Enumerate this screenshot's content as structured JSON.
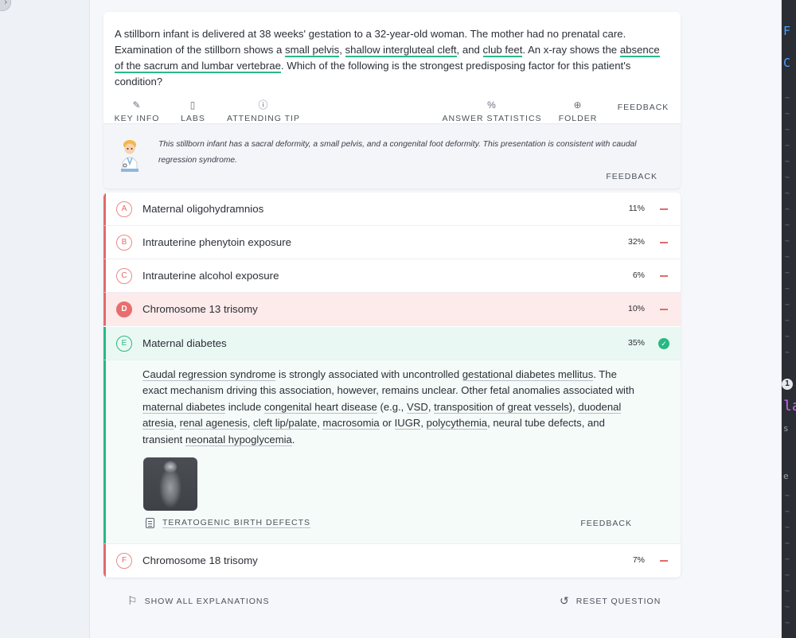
{
  "question": {
    "stem_parts": [
      "A stillborn infant is delivered at 38 weeks' gestation to a 32-year-old woman. The mother had no prenatal care. Examination of the stillborn shows a ",
      "small pelvis",
      ", ",
      "shallow intergluteal cleft",
      ", and ",
      "club feet",
      ". An x-ray shows the ",
      "absence of the sacrum and lumbar vertebrae",
      ". Which of the following is the strongest predisposing factor for this patient's condition?"
    ]
  },
  "toolbar": {
    "key_info": "KEY INFO",
    "labs": "LABS",
    "attending_tip": "ATTENDING TIP",
    "answer_statistics": "ANSWER STATISTICS",
    "folder": "FOLDER",
    "feedback": "FEEDBACK",
    "icons": {
      "key_info": "pencil-icon",
      "labs": "clipboard-icon",
      "attending_tip": "question-circle-icon",
      "answer_statistics": "percent-icon",
      "folder": "plus-circle-icon"
    }
  },
  "tip": {
    "text": "This stillborn infant has a sacral deformity, a small pelvis, and a congenital foot deformity. This presentation is consistent with caudal regression syndrome.",
    "feedback": "FEEDBACK"
  },
  "options": [
    {
      "letter": "A",
      "text": "Maternal oligohydramnios",
      "pct": "11%"
    },
    {
      "letter": "B",
      "text": "Intrauterine phenytoin exposure",
      "pct": "32%"
    },
    {
      "letter": "C",
      "text": "Intrauterine alcohol exposure",
      "pct": "6%"
    },
    {
      "letter": "D",
      "text": "Chromosome 13 trisomy",
      "pct": "10%"
    },
    {
      "letter": "E",
      "text": "Maternal diabetes",
      "pct": "35%"
    },
    {
      "letter": "F",
      "text": "Chromosome 18 trisomy",
      "pct": "7%"
    }
  ],
  "explanation": {
    "p": [
      "Caudal regression syndrome",
      " is strongly associated with uncontrolled ",
      "gestational diabetes mellitus",
      ". The exact mechanism driving this association, however, remains unclear. Other fetal anomalies associated with ",
      "maternal diabetes",
      " include ",
      "congenital heart disease",
      " (e.g., ",
      "VSD",
      ", ",
      "transposition of great vessels",
      "), ",
      "duodenal atresia",
      ", ",
      "renal agenesis",
      ", ",
      "cleft lip/palate",
      ", ",
      "macrosomia",
      " or ",
      "IUGR",
      ", ",
      "polycythemia",
      ", neural tube defects, and transient ",
      "neonatal hypoglycemia",
      "."
    ],
    "reference": "TERATOGENIC BIRTH DEFECTS",
    "feedback": "FEEDBACK"
  },
  "footer": {
    "show_all": "SHOW ALL EXPLANATIONS",
    "reset": "RESET QUESTION"
  },
  "right_strip": {
    "glyphs": [
      "F",
      "C",
      "1",
      "la",
      "s",
      "e"
    ]
  },
  "colors": {
    "correct": "#28b885",
    "incorrect": "#e06b6b",
    "highlight": "#29b98a"
  }
}
